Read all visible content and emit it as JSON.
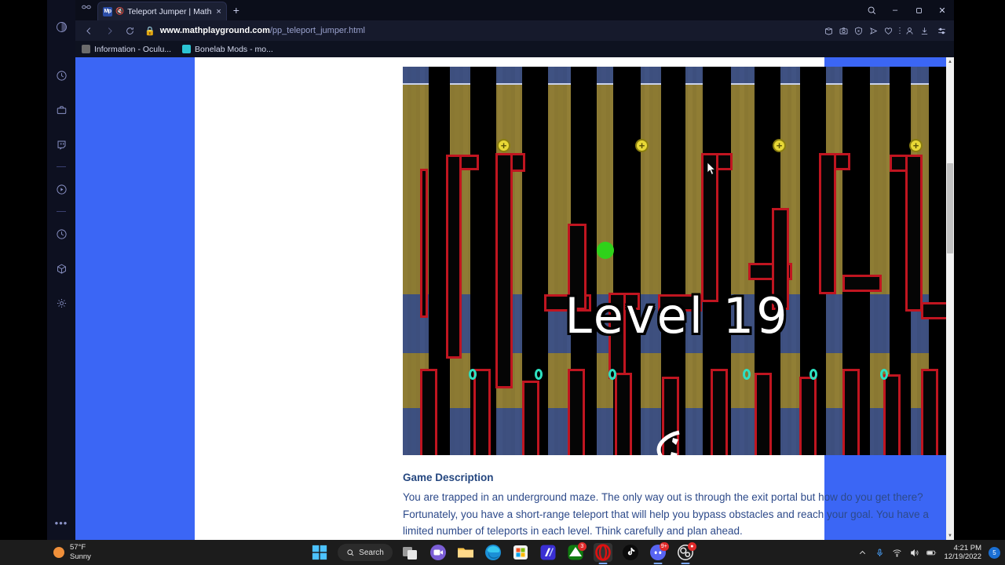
{
  "browser": {
    "tab": {
      "favicon_label": "Mp",
      "mute_icon": "speaker-muted-icon",
      "title": "Teleport Jumper | Math",
      "close_icon": "×"
    },
    "new_tab_label": "+",
    "tab_search_icon": "tab-search-icon",
    "profile_icon": "profile-circle-icon",
    "window_controls": {
      "minimize": "–",
      "maximize": "❐",
      "close": "✕"
    },
    "nav": {
      "back": "‹",
      "forward": "›",
      "reload": "⟳",
      "lock": "lock-icon"
    },
    "url": {
      "domain": "www.mathplayground.com",
      "path": "/pp_teleport_jumper.html"
    },
    "toolbar_icons": [
      "collections-icon",
      "screenshot-icon",
      "browser-essentials-icon",
      "send-icon",
      "favorites-heart-icon",
      "more-dots-icon",
      "profile-person-icon",
      "downloads-icon",
      "settings-sliders-icon"
    ],
    "bookmarks": [
      {
        "label": "Information - Oculu...",
        "color": "#6b6b6b"
      },
      {
        "label": "Bonelab Mods - mo...",
        "color": "#2bc4d4"
      }
    ],
    "rail_icons": [
      "copilot-circle-icon",
      "search-compass-icon",
      "briefcase-icon",
      "twitch-icon",
      "divider",
      "play-circle-icon",
      "divider",
      "history-clock-icon",
      "box-3d-icon",
      "gear-icon"
    ],
    "rail_more": "•••",
    "scrollbar": {
      "up": "▲",
      "down": "▼"
    }
  },
  "page": {
    "background_color": "#3b66f5",
    "paper_color": "#ffffff",
    "game": {
      "level_text": "Level 19",
      "coin_icon": "+",
      "player_icon": "player-character",
      "portal_icon": "teleport-portal",
      "colors": {
        "wall_fill": "#050505",
        "wall_outline": "#c01520",
        "dirt": "#8a7832",
        "stone": "#3d4f7e",
        "coin": "#e8d836",
        "portal": "#2ee0c0"
      }
    },
    "description": {
      "heading": "Game Description",
      "body": "You are trapped in an underground maze. The only way out is through the exit portal but how do you get there? Fortunately, you have a short-range teleport that will help you bypass obstacles and reach your goal. You have a limited number of teleports in each level. Think carefully and plan ahead."
    }
  },
  "taskbar": {
    "weather": {
      "temperature": "57°F",
      "condition": "Sunny"
    },
    "start_label": "start-button",
    "search_label": "Search",
    "apps": [
      {
        "name": "task-view-icon",
        "badge": "",
        "running": false
      },
      {
        "name": "meet-now-camera-icon",
        "badge": "",
        "running": false
      },
      {
        "name": "file-explorer-icon",
        "badge": "",
        "running": false
      },
      {
        "name": "microsoft-edge-icon",
        "badge": "",
        "running": false
      },
      {
        "name": "microsoft-store-icon",
        "badge": "",
        "running": false
      },
      {
        "name": "media-app-icon",
        "badge": "",
        "running": false
      },
      {
        "name": "xbox-icon",
        "badge": "3",
        "running": false
      },
      {
        "name": "opera-gx-icon",
        "badge": "",
        "running": true
      },
      {
        "name": "tiktok-icon",
        "badge": "",
        "running": false
      },
      {
        "name": "discord-icon",
        "badge": "9+",
        "running": true
      },
      {
        "name": "obs-studio-icon",
        "badge": "●",
        "running": true
      }
    ],
    "tray": {
      "chevron": "show-hidden-icons",
      "mic": "microphone-icon",
      "wifi": "wifi-icon",
      "volume": "volume-icon",
      "battery": "battery-icon",
      "time": "4:21 PM",
      "date": "12/19/2022",
      "notification_count": "5"
    }
  }
}
